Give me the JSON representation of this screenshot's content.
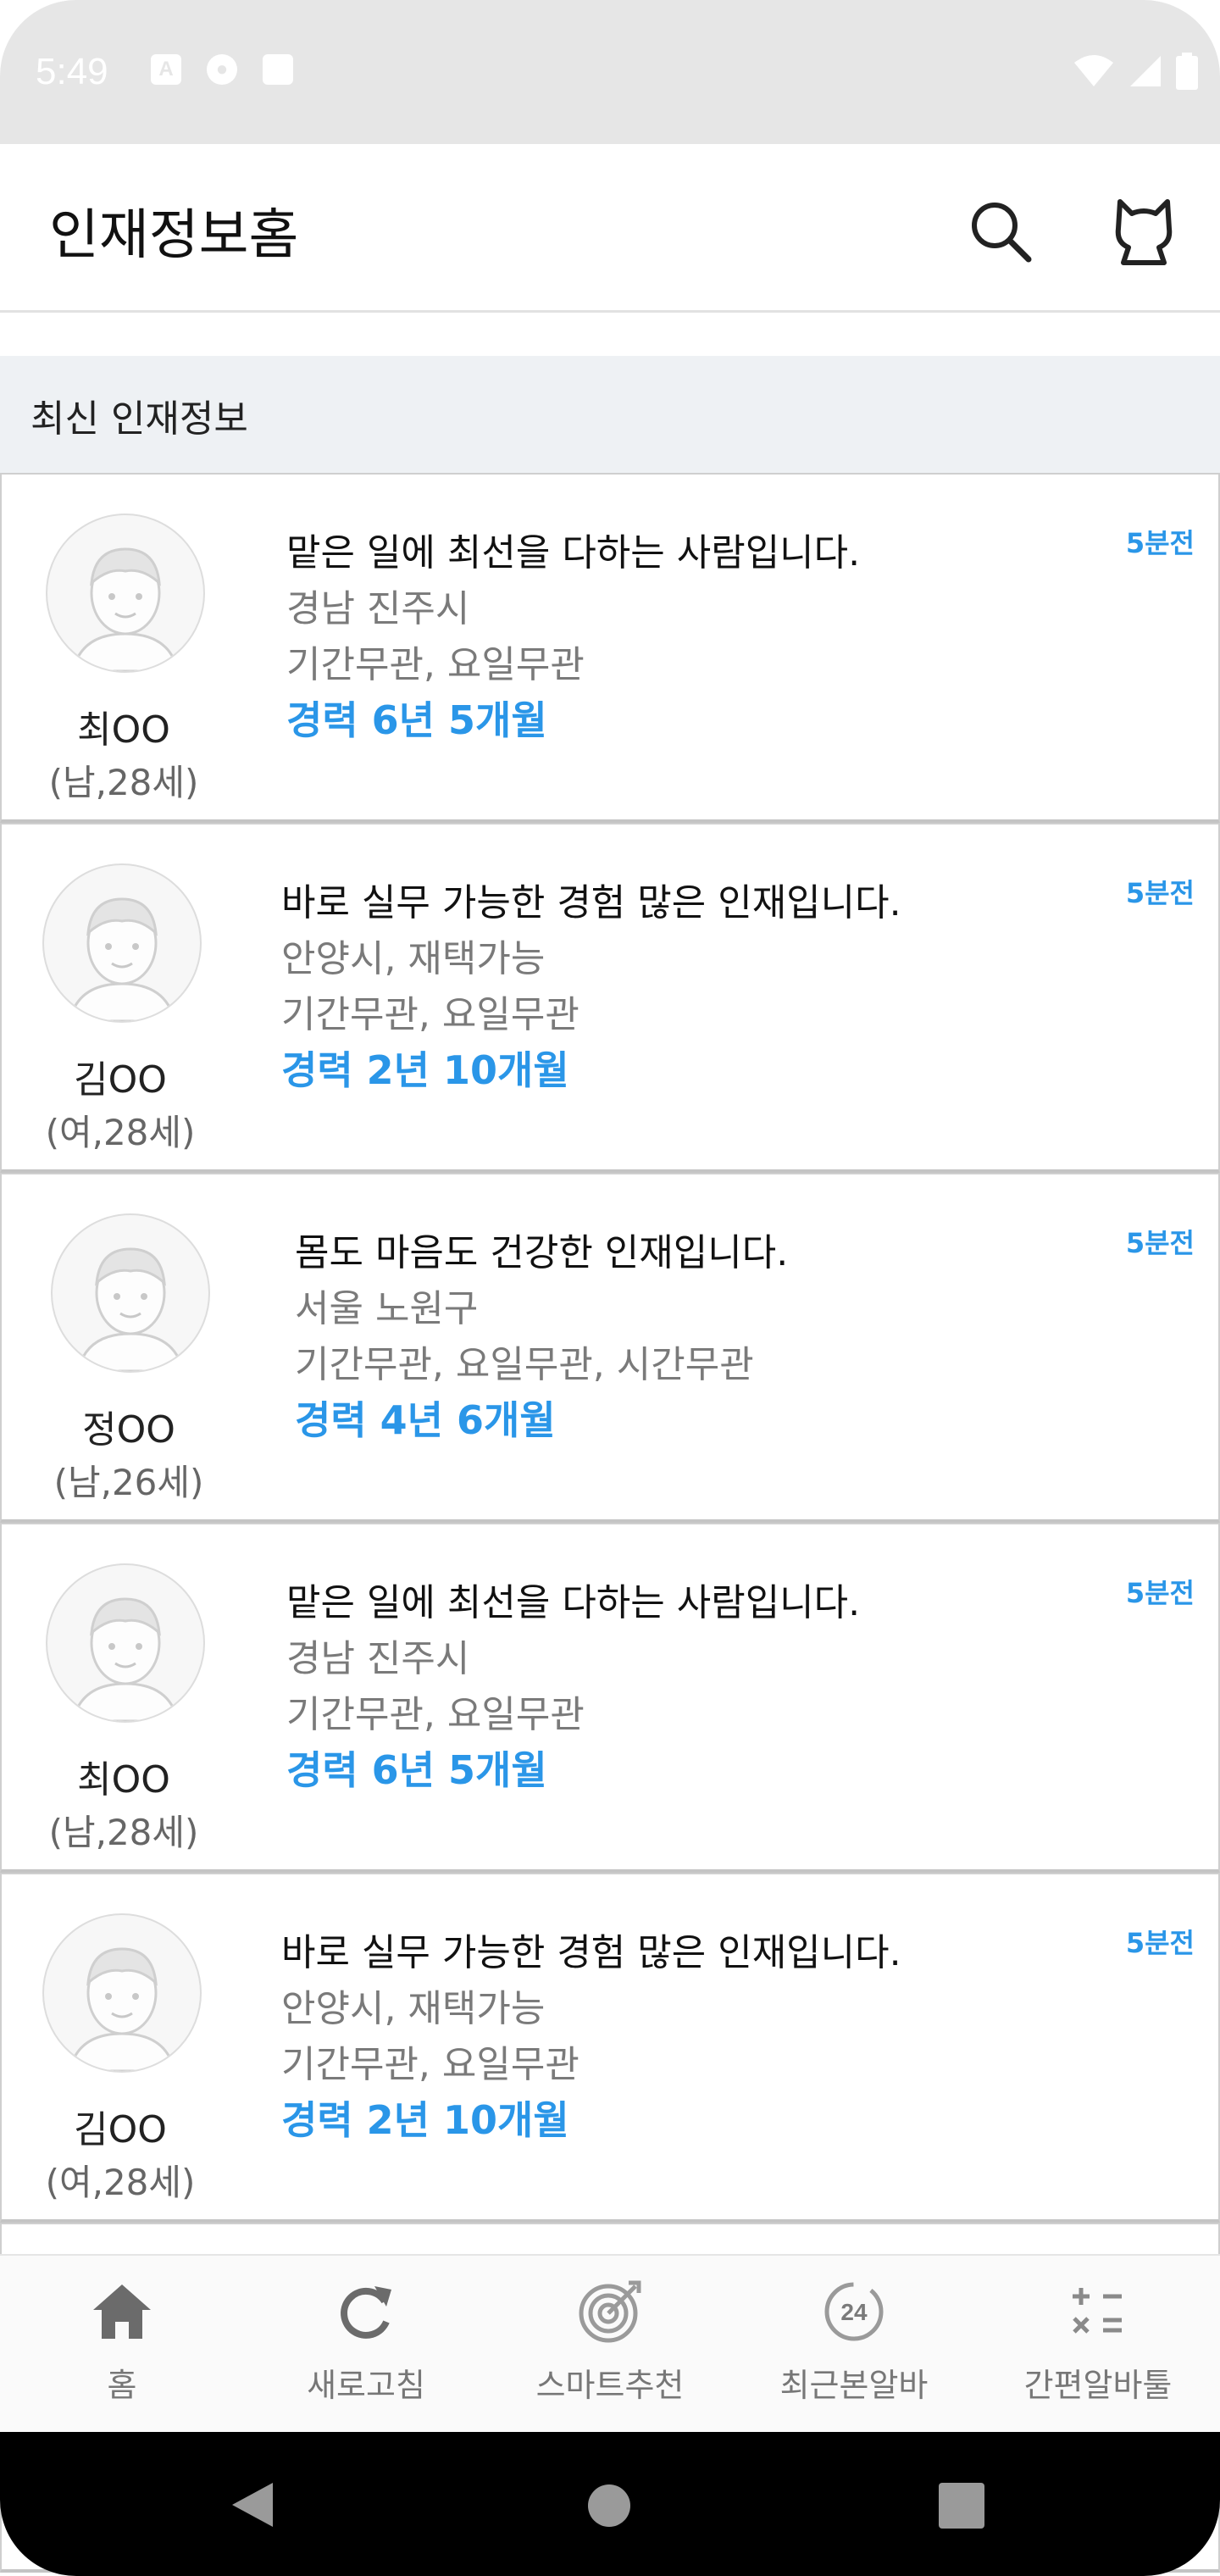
{
  "status_bar": {
    "time": "5:49",
    "icons": [
      "a-icon",
      "cloud-icon",
      "sd-card-icon"
    ],
    "right_icons": [
      "wifi-icon",
      "signal-icon",
      "battery-icon"
    ]
  },
  "app_bar": {
    "title": "인재정보홈"
  },
  "section": {
    "title": "최신 인재정보"
  },
  "cards": [
    {
      "name": "최OO",
      "info": "(남,28세)",
      "intro": "맡은 일에 최선을 다하는 사람입니다.",
      "location": "경남 진주시",
      "conditions": "기간무관, 요일무관",
      "career": "경력 6년 5개월",
      "time": "5분전"
    },
    {
      "name": "김OO",
      "info": "(여,28세)",
      "intro": "바로 실무 가능한 경험 많은 인재입니다.",
      "location": "안양시, 재택가능",
      "conditions": "기간무관, 요일무관",
      "career": "경력 2년 10개월",
      "time": "5분전"
    },
    {
      "name": "정OO",
      "info": "(남,26세)",
      "intro": "몸도 마음도 건강한 인재입니다.",
      "location": "서울 노원구",
      "conditions": "기간무관, 요일무관, 시간무관",
      "career": "경력 4년 6개월",
      "time": "5분전"
    },
    {
      "name": "최OO",
      "info": "(남,28세)",
      "intro": "맡은 일에 최선을 다하는 사람입니다.",
      "location": "경남 진주시",
      "conditions": "기간무관, 요일무관",
      "career": "경력 6년 5개월",
      "time": "5분전"
    },
    {
      "name": "김OO",
      "info": "(여,28세)",
      "intro": "바로 실무 가능한 경험 많은 인재입니다.",
      "location": "안양시, 재택가능",
      "conditions": "기간무관, 요일무관",
      "career": "경력 2년 10개월",
      "time": "5분전"
    }
  ],
  "bottom_nav": [
    {
      "label": "홈",
      "icon": "home-icon"
    },
    {
      "label": "새로고침",
      "icon": "refresh-icon"
    },
    {
      "label": "스마트추천",
      "icon": "target-icon"
    },
    {
      "label": "최근본알바",
      "icon": "24-hours-icon"
    },
    {
      "label": "간편알바툴",
      "icon": "calculator-icon"
    }
  ],
  "colors": {
    "accent": "#2a96e8",
    "status_bar": "#e6e6e6",
    "section_bg": "#eef1f4"
  }
}
